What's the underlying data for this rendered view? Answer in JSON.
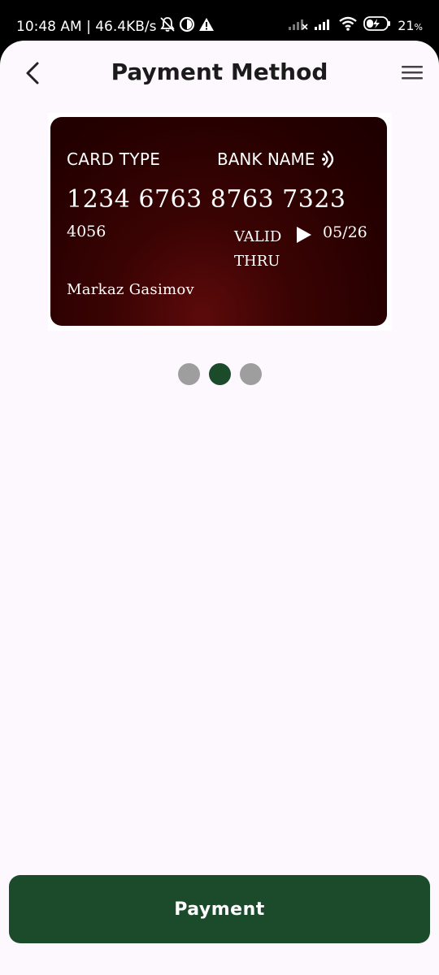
{
  "status_bar": {
    "time_speed": "10:48 AM | 46.4KB/s",
    "battery": "21",
    "battery_unit": "%",
    "icons": [
      "alarm-off-icon",
      "data-saver-icon",
      "warning-icon",
      "signal-weak-icon",
      "signal-icon",
      "wifi-icon",
      "battery-charging-icon"
    ]
  },
  "header": {
    "title": "Payment Method",
    "back_icon": "chevron-left-icon",
    "menu_icon": "hamburger-menu-icon"
  },
  "card": {
    "card_type": "CARD TYPE",
    "bank_name": "BANK NAME",
    "contactless_icon": "contactless-icon",
    "number": "1234 6763 8763 7323",
    "code": "4056",
    "valid_line1": "VALID",
    "valid_line2": "THRU",
    "expiry": "05/26",
    "holder": "Markaz Gasimov",
    "color": "#3a0303"
  },
  "pager": {
    "count": 3,
    "active_index": 1,
    "active_color": "#1b4b2b",
    "inactive_color": "#9e9e9e"
  },
  "footer": {
    "payment_label": "Payment",
    "accent": "#1b4b2b"
  }
}
